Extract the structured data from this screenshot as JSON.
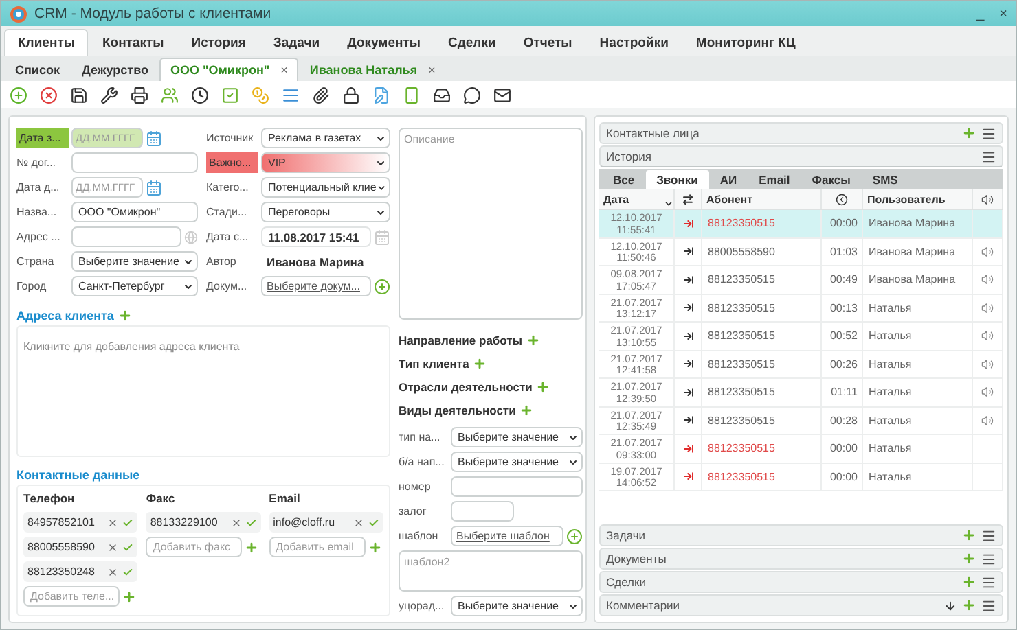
{
  "window": {
    "title": "CRM - Модуль работы с клиентами",
    "controls": [
      "_",
      "×"
    ]
  },
  "menu": [
    {
      "label": "Клиенты",
      "selected": true
    },
    {
      "label": "Контакты",
      "selected": false
    },
    {
      "label": "История",
      "selected": false
    },
    {
      "label": "Задачи",
      "selected": false
    },
    {
      "label": "Документы",
      "selected": false
    },
    {
      "label": "Сделки",
      "selected": false
    },
    {
      "label": "Отчеты",
      "selected": false
    },
    {
      "label": "Настройки",
      "selected": false
    },
    {
      "label": "Мониторинг КЦ",
      "selected": false
    }
  ],
  "subtabs": [
    {
      "label": "Список",
      "kind": "section",
      "selected": false
    },
    {
      "label": "Дежурство",
      "kind": "section",
      "selected": false
    },
    {
      "label": "ООО \"Омикрон\"",
      "kind": "record",
      "selected": true,
      "close": "×"
    },
    {
      "label": "Иванова Наталья",
      "kind": "record",
      "selected": false,
      "close": "×"
    }
  ],
  "form": {
    "columns": [
      [
        {
          "label": "Дата з...",
          "kind": "date",
          "placeholder": "ДД.ММ.ГГГГ",
          "color": "#8cc63f"
        },
        {
          "label": "№ дог...",
          "kind": "text"
        },
        {
          "label": "Дата д...",
          "kind": "date",
          "placeholder": "ДД.ММ.ГГГГ"
        },
        {
          "label": "Назва...",
          "kind": "text",
          "value": "ООО \"Омикрон\""
        },
        {
          "label": "Адрес ...",
          "kind": "address"
        },
        {
          "label": "Страна",
          "kind": "select",
          "value": "Выберите значение"
        },
        {
          "label": "Город",
          "kind": "select",
          "value": "Санкт-Петербург"
        }
      ],
      [
        {
          "label": "Источник",
          "kind": "select",
          "value": "Реклама в газетах"
        },
        {
          "label": "Важно...",
          "kind": "select",
          "value": "VIP",
          "color": "#f07070"
        },
        {
          "label": "Катего...",
          "kind": "select",
          "value": "Потенциальный клие"
        },
        {
          "label": "Стади...",
          "kind": "select",
          "value": "Переговоры"
        },
        {
          "label": "Дата с...",
          "kind": "stamp",
          "value": "11.08.2017 15:41"
        },
        {
          "label": "Автор",
          "kind": "readonly",
          "value": "Иванова Марина"
        },
        {
          "label": "Докум...",
          "kind": "link",
          "value": "Выберите докум..."
        }
      ]
    ],
    "description": {
      "placeholder": "Описание"
    }
  },
  "address": {
    "title": "Адреса клиента",
    "hint": "Кликните для добавления адреса клиента"
  },
  "contacts": {
    "title": "Контактные данные",
    "groups": [
      {
        "label": "Телефон",
        "items": [
          "84957852101",
          "88005558590",
          "88123350248"
        ],
        "placeholder": "Добавить теле..."
      },
      {
        "label": "Факс",
        "items": [
          "88133229100"
        ],
        "placeholder": "Добавить факс"
      },
      {
        "label": "Email",
        "items": [
          "info@cloff.ru"
        ],
        "placeholder": "Добавить email"
      }
    ]
  },
  "sections": [
    "Направление работы",
    "Тип клиента",
    "Отрасли деятельности",
    "Виды деятельности"
  ],
  "extra_fields": [
    {
      "label": "тип на...",
      "kind": "select",
      "value": "Выберите значение"
    },
    {
      "label": "б/а нап...",
      "kind": "select",
      "value": "Выберите значение"
    },
    {
      "label": "номер",
      "kind": "text"
    },
    {
      "label": "залог",
      "kind": "short"
    },
    {
      "label": "шаблон",
      "kind": "link",
      "value": "Выберите шаблон"
    },
    {
      "kind": "textarea",
      "placeholder": "шаблон2"
    },
    {
      "label": "уцорад...",
      "kind": "select",
      "value": "Выберите значение"
    }
  ],
  "panels_top": [
    {
      "title": "Контактные лица",
      "add": true,
      "expanded": false
    },
    {
      "title": "История",
      "add": false,
      "expanded": true
    }
  ],
  "history": {
    "tabs": [
      {
        "label": "Все",
        "selected": false
      },
      {
        "label": "Звонки",
        "selected": true
      },
      {
        "label": "АИ",
        "selected": false
      },
      {
        "label": "Email",
        "selected": false
      },
      {
        "label": "Факсы",
        "selected": false
      },
      {
        "label": "SMS",
        "selected": false
      }
    ],
    "columns": [
      "Дата",
      "Абонент",
      "Пользователь"
    ],
    "rows": [
      {
        "date": "12.10.2017",
        "time": "11:55:41",
        "missed": true,
        "number": "88123350515",
        "duration": "00:00",
        "user": "Иванова Марина",
        "recording": false,
        "selected": true
      },
      {
        "date": "12.10.2017",
        "time": "11:50:46",
        "missed": false,
        "number": "88005558590",
        "duration": "01:03",
        "user": "Иванова Марина",
        "recording": true,
        "selected": false
      },
      {
        "date": "09.08.2017",
        "time": "17:05:47",
        "missed": false,
        "number": "88123350515",
        "duration": "00:49",
        "user": "Иванова Марина",
        "recording": true,
        "selected": false
      },
      {
        "date": "21.07.2017",
        "time": "13:12:17",
        "missed": false,
        "number": "88123350515",
        "duration": "00:13",
        "user": "Наталья",
        "recording": true,
        "selected": false
      },
      {
        "date": "21.07.2017",
        "time": "13:10:55",
        "missed": false,
        "number": "88123350515",
        "duration": "00:52",
        "user": "Наталья",
        "recording": true,
        "selected": false
      },
      {
        "date": "21.07.2017",
        "time": "12:41:58",
        "missed": false,
        "number": "88123350515",
        "duration": "00:26",
        "user": "Наталья",
        "recording": true,
        "selected": false
      },
      {
        "date": "21.07.2017",
        "time": "12:39:50",
        "missed": false,
        "number": "88123350515",
        "duration": "01:11",
        "user": "Наталья",
        "recording": true,
        "selected": false
      },
      {
        "date": "21.07.2017",
        "time": "12:35:49",
        "missed": false,
        "number": "88123350515",
        "duration": "00:28",
        "user": "Наталья",
        "recording": true,
        "selected": false
      },
      {
        "date": "21.07.2017",
        "time": "09:33:00",
        "missed": true,
        "number": "88123350515",
        "duration": "00:00",
        "user": "Наталья",
        "recording": false,
        "selected": false
      },
      {
        "date": "19.07.2017",
        "time": "14:06:52",
        "missed": true,
        "number": "88123350515",
        "duration": "00:00",
        "user": "Наталья",
        "recording": false,
        "selected": false
      }
    ]
  },
  "panels_bottom": [
    {
      "title": "Задачи",
      "add": true,
      "sort": false
    },
    {
      "title": "Документы",
      "add": true,
      "sort": false
    },
    {
      "title": "Сделки",
      "add": true,
      "sort": false
    },
    {
      "title": "Комментарии",
      "add": true,
      "sort": true
    }
  ]
}
